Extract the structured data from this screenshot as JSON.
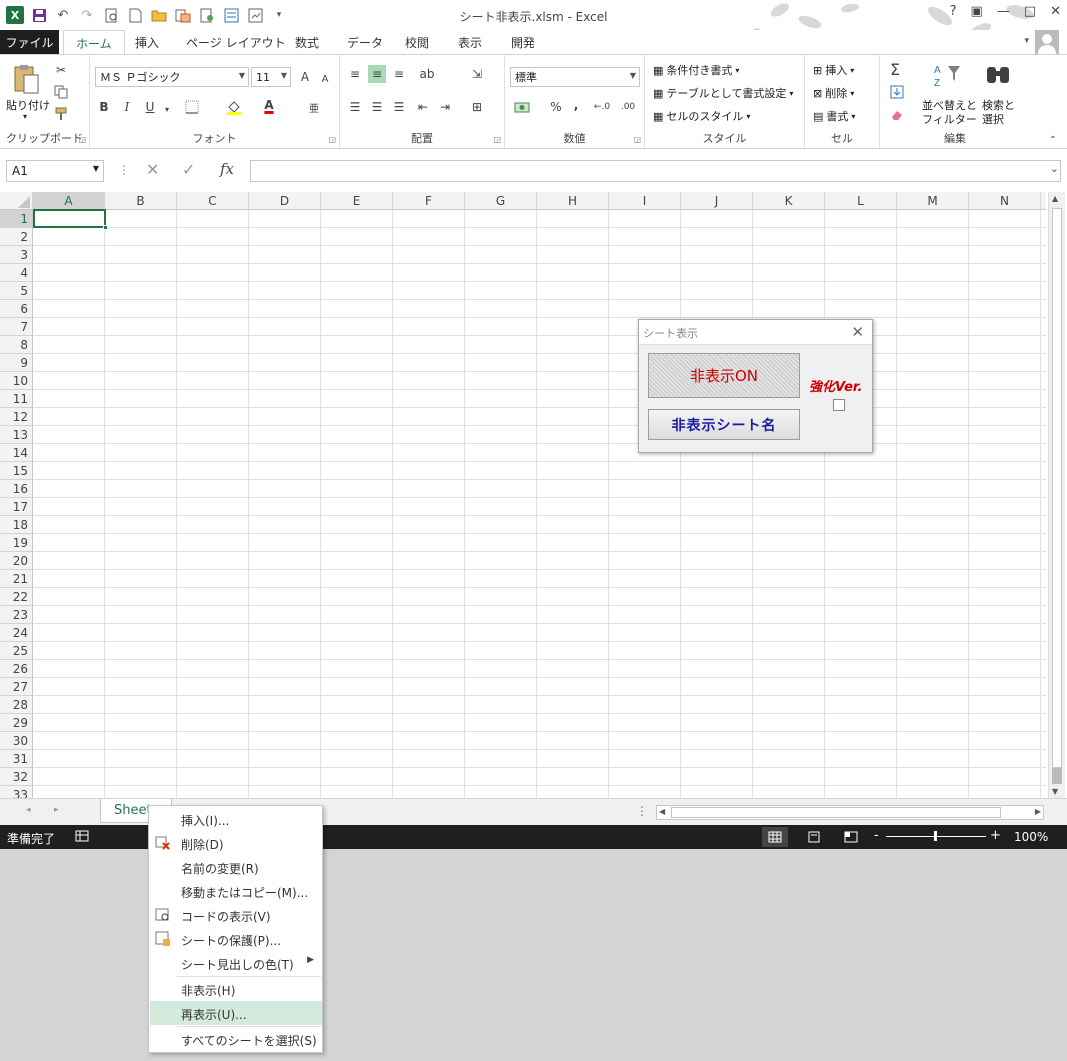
{
  "window": {
    "title": "シート非表示.xlsm - Excel",
    "help": "?",
    "minimize": "—",
    "restore": "□",
    "close": "✕"
  },
  "qat": {
    "undo": "↶",
    "redo": "↷"
  },
  "ribbon_tabs": [
    "ファイル",
    "ホーム",
    "挿入",
    "ページ レイアウト",
    "数式",
    "データ",
    "校閲",
    "表示",
    "開発"
  ],
  "ribbon": {
    "clipboard": {
      "paste_label": "貼り付け",
      "group": "クリップボード"
    },
    "font": {
      "name": "ＭＳ Ｐゴシック",
      "size": "11",
      "bold": "B",
      "italic": "I",
      "underline": "U",
      "group": "フォント",
      "grow": "A",
      "shrink": "A",
      "color_letter": "A"
    },
    "alignment": {
      "group": "配置"
    },
    "number": {
      "format": "標準",
      "percent": "%",
      "comma": ",",
      "group": "数値"
    },
    "styles": {
      "conditional": "条件付き書式",
      "table": "テーブルとして書式設定",
      "cell": "セルのスタイル",
      "group": "スタイル"
    },
    "cells": {
      "insert": "挿入",
      "delete": "削除",
      "format": "書式",
      "group": "セル"
    },
    "editing": {
      "sort": "並べ替えと",
      "filter": "フィルター",
      "find": "検索と",
      "select": "選択",
      "sigma": "Σ",
      "group": "編集"
    }
  },
  "formula_bar": {
    "name_box": "A1",
    "fx": "fx",
    "value": ""
  },
  "columns": [
    "A",
    "B",
    "C",
    "D",
    "E",
    "F",
    "G",
    "H",
    "I",
    "J",
    "K",
    "L",
    "M",
    "N"
  ],
  "rows": [
    "1",
    "2",
    "3",
    "4",
    "5",
    "6",
    "7",
    "8",
    "9",
    "10",
    "11",
    "12",
    "13",
    "14",
    "15",
    "16",
    "17",
    "18",
    "19",
    "20",
    "21",
    "22",
    "23",
    "24",
    "25",
    "26",
    "27",
    "28",
    "29",
    "30",
    "31",
    "32",
    "33"
  ],
  "sheet_tab": "Sheet",
  "status": {
    "ready": "準備完了",
    "zoom": "100%"
  },
  "userform": {
    "title": "シート表示",
    "btn_on": "非表示ON",
    "btn_names": "非表示シート名",
    "enhanced_label": "強化Ver."
  },
  "context_menu": {
    "items": [
      {
        "label": "挿入(I)..."
      },
      {
        "label": "削除(D)"
      },
      {
        "label": "名前の変更(R)"
      },
      {
        "label": "移動またはコピー(M)..."
      },
      {
        "label": "コードの表示(V)"
      },
      {
        "label": "シートの保護(P)..."
      },
      {
        "label": "シート見出しの色(T)"
      },
      {
        "label": "非表示(H)"
      },
      {
        "label": "再表示(U)..."
      },
      {
        "label": "すべてのシートを選択(S)"
      }
    ]
  },
  "colors": {
    "excel_green": "#217346",
    "form_red": "#cc0000",
    "form_blue": "#1a1aa0",
    "menu_highlight": "#d3eadd"
  }
}
